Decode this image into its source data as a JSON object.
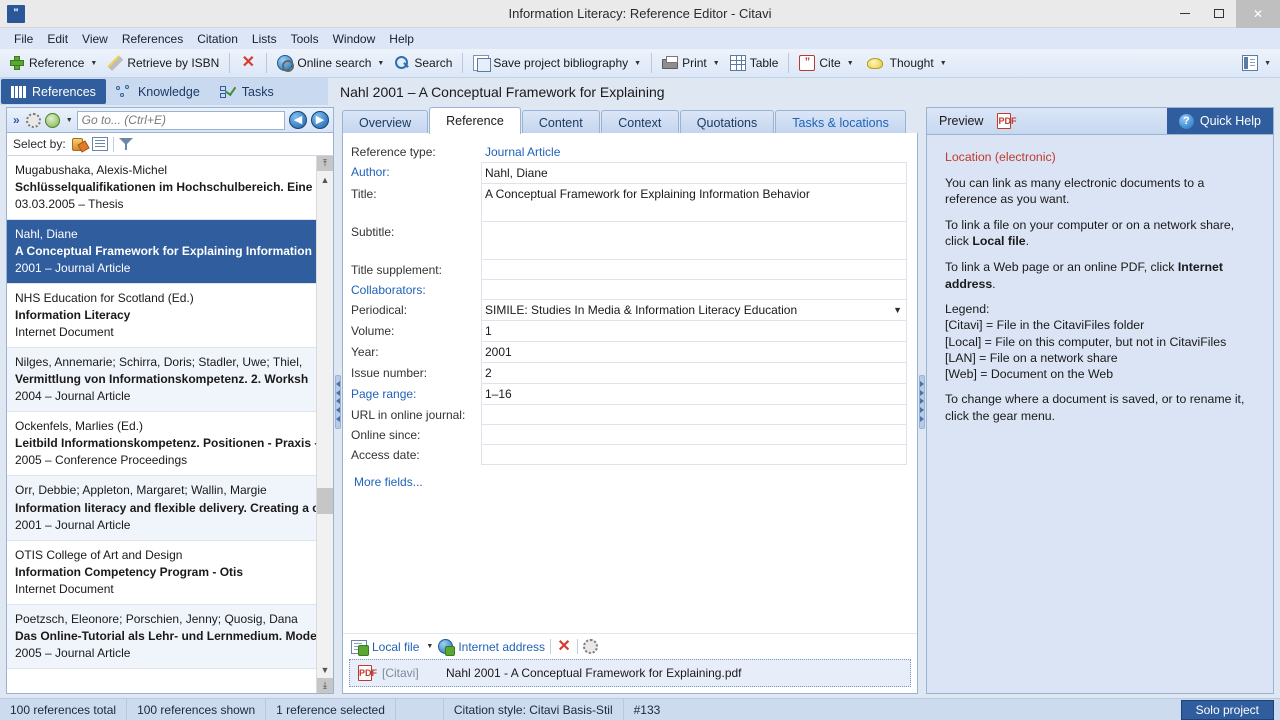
{
  "window": {
    "title": "Information Literacy: Reference Editor - Citavi",
    "logo_glyph": "\"",
    "minimize": "—",
    "maximize": "□",
    "close": "✕"
  },
  "menubar": {
    "items": [
      "File",
      "Edit",
      "View",
      "References",
      "Citation",
      "Lists",
      "Tools",
      "Window",
      "Help"
    ]
  },
  "toolbar": {
    "items": [
      {
        "label": "Reference",
        "icon": "plus-icon",
        "caret": true
      },
      {
        "label": "Retrieve by ISBN",
        "icon": "wand-icon",
        "caret": false
      },
      {
        "label": "",
        "icon": "delete-x-icon",
        "caret": false
      },
      {
        "label": "Online search",
        "icon": "globe-search-icon",
        "caret": true
      },
      {
        "label": "Search",
        "icon": "magnifier-icon",
        "caret": false
      },
      {
        "label": "Save project bibliography",
        "icon": "bibliography-icon",
        "caret": true
      },
      {
        "label": "Print",
        "icon": "printer-icon",
        "caret": true
      },
      {
        "label": "Table",
        "icon": "table-icon",
        "caret": false
      },
      {
        "label": "Cite",
        "icon": "quote-icon",
        "caret": true
      },
      {
        "label": "Thought",
        "icon": "lightbulb-icon",
        "caret": true
      },
      {
        "label": "",
        "icon": "layout-icon",
        "caret": true
      }
    ]
  },
  "mode_tabs": [
    {
      "label": "References",
      "icon": "books-icon",
      "active": true
    },
    {
      "label": "Knowledge",
      "icon": "nodes-icon",
      "active": false
    },
    {
      "label": "Tasks",
      "icon": "task-check-icon",
      "active": false
    }
  ],
  "record_title": "Nahl 2001 – A Conceptual Framework for Explaining",
  "left_panel": {
    "goto_placeholder": "Go to... (Ctrl+E)",
    "goto_value": "",
    "chevron": "»",
    "nav_back": "◀",
    "nav_forward": "▶",
    "select_by_label": "Select by:",
    "references": [
      {
        "authors": "Mugabushaka, Alexis-Michel",
        "title": "Schlüsselqualifikationen im Hochschulbereich. Eine di",
        "meta": "03.03.2005 – Thesis",
        "selected": false
      },
      {
        "authors": "Nahl, Diane",
        "title": "A Conceptual Framework for Explaining Information",
        "meta": "2001 – Journal Article",
        "selected": true
      },
      {
        "authors": "NHS Education for Scotland (Ed.)",
        "title": "Information Literacy",
        "meta": "Internet Document",
        "selected": false
      },
      {
        "authors": "Nilges, Annemarie; Schirra, Doris; Stadler, Uwe; Thiel,",
        "title": "Vermittlung von Informationskompetenz. 2. Worksh",
        "meta": "2004 – Journal Article",
        "selected": false
      },
      {
        "authors": "Ockenfels, Marlies (Ed.)",
        "title": "Leitbild Informationskompetenz. Positionen - Praxis -",
        "meta": "2005 – Conference Proceedings",
        "selected": false
      },
      {
        "authors": "Orr, Debbie; Appleton, Margaret; Wallin, Margie",
        "title": "Information literacy and flexible delivery. Creating a c",
        "meta": "2001 – Journal Article",
        "selected": false
      },
      {
        "authors": "OTIS College of Art and Design",
        "title": "Information Competency Program - Otis",
        "meta": "Internet Document",
        "selected": false
      },
      {
        "authors": "Poetzsch, Eleonore; Porschien, Jenny; Quosig, Dana",
        "title": "Das Online-Tutorial als Lehr- und Lernmedium. Model",
        "meta": "2005 – Journal Article",
        "selected": false
      }
    ]
  },
  "center_panel": {
    "tabs": [
      {
        "label": "Overview",
        "active": false,
        "link": false
      },
      {
        "label": "Reference",
        "active": true,
        "link": false
      },
      {
        "label": "Content",
        "active": false,
        "link": false
      },
      {
        "label": "Context",
        "active": false,
        "link": false
      },
      {
        "label": "Quotations",
        "active": false,
        "link": false
      },
      {
        "label": "Tasks & locations",
        "active": false,
        "link": true
      }
    ],
    "fields": [
      {
        "label": "Reference type:",
        "value": "Journal Article",
        "style": "plain",
        "label_link": false
      },
      {
        "label": "Author:",
        "value": "Nahl, Diane",
        "style": "boxed-top",
        "label_link": true
      },
      {
        "label": "Title:",
        "value": "A Conceptual Framework for Explaining Information Behavior",
        "style": "boxed-tall",
        "label_link": false
      },
      {
        "label": "Subtitle:",
        "value": "",
        "style": "boxed-tall",
        "label_link": false
      },
      {
        "label": "Title supplement:",
        "value": "",
        "style": "boxed",
        "label_link": false
      },
      {
        "label": "Collaborators:",
        "value": "",
        "style": "boxed",
        "label_link": true
      },
      {
        "label": "Periodical:",
        "value": "SIMILE: Studies In Media & Information Literacy Education",
        "style": "combo",
        "label_link": false
      },
      {
        "label": "Volume:",
        "value": "1",
        "style": "boxed",
        "label_link": false
      },
      {
        "label": "Year:",
        "value": "2001",
        "style": "boxed",
        "label_link": false
      },
      {
        "label": "Issue number:",
        "value": "2",
        "style": "boxed",
        "label_link": false
      },
      {
        "label": "Page range:",
        "value": "1–16",
        "style": "boxed",
        "label_link": true
      },
      {
        "label": "URL in online journal:",
        "value": "",
        "style": "boxed",
        "label_link": false
      },
      {
        "label": "Online since:",
        "value": "",
        "style": "boxed",
        "label_link": false
      },
      {
        "label": "Access date:",
        "value": "",
        "style": "boxed",
        "label_link": false
      }
    ],
    "more_fields": "More fields...",
    "attachment_toolbar": {
      "local_file": "Local file",
      "internet_address": "Internet address",
      "delete": "✕",
      "gear": "⚙"
    },
    "attachment": {
      "tag": "[Citavi]",
      "filename": "Nahl 2001 - A Conceptual Framework for Explaining.pdf"
    }
  },
  "right_panel": {
    "preview_label": "Preview",
    "pdf_icon": "pdf-icon",
    "quick_help_label": "Quick Help",
    "help": {
      "title": "Location (electronic)",
      "paragraphs": [
        "You can link as many electronic documents to a reference as you want.",
        "To link a file on your computer or on a network share, click Local file.",
        "To link a Web page or an online PDF, click Internet address."
      ],
      "legend_heading": "Legend:",
      "legend": [
        "[Citavi] = File in the CitaviFiles folder",
        "[Local] = File on this computer, but not in CitaviFiles",
        "[LAN] = File on a network share",
        "[Web] = Document on the Web"
      ],
      "closing": "To change where a document is saved, or to rename it, click the gear menu."
    }
  },
  "statusbar": {
    "total": "100 references total",
    "shown": "100 references shown",
    "selected": "1 reference selected",
    "citation_style": "Citation style: Citavi Basis-Stil",
    "record_number": "#133",
    "project_mode": "Solo project"
  },
  "colors": {
    "accent": "#2f5d9e",
    "link": "#1f62b8",
    "help_title": "#c0392b",
    "selection": "#2f5d9e"
  }
}
